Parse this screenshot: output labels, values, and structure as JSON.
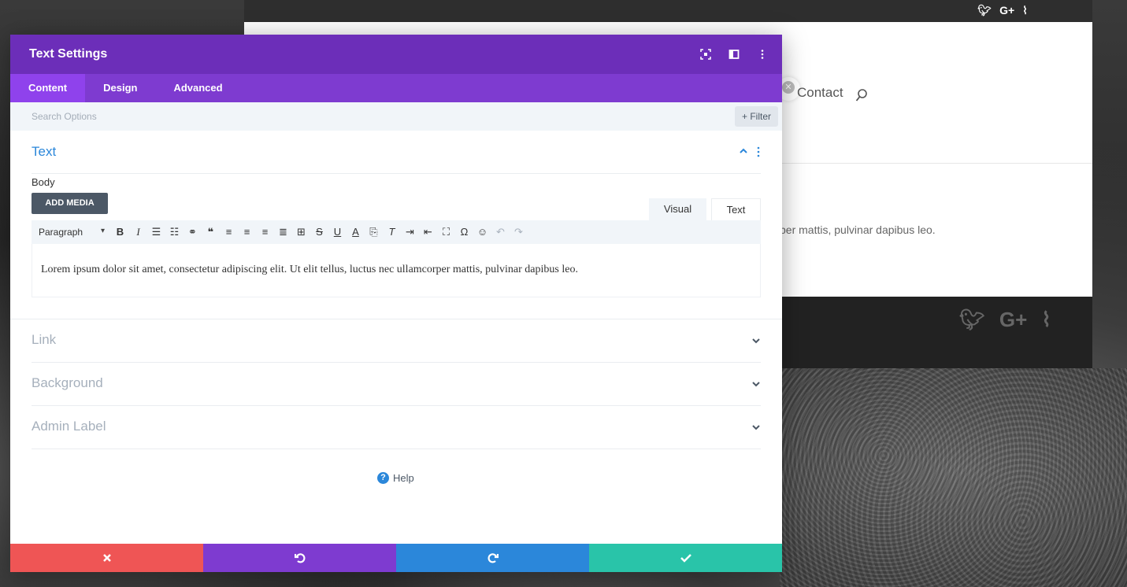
{
  "site": {
    "nav_contact": "Contact",
    "body_text": "per mattis, pulvinar dapibus leo.",
    "social_icons": [
      "twitter-icon",
      "google-plus-icon",
      "rss-icon"
    ]
  },
  "modal": {
    "title": "Text Settings",
    "header_icons": [
      "fullscreen-icon",
      "split-view-icon",
      "more-options-icon"
    ],
    "tabs": [
      {
        "label": "Content",
        "active": true
      },
      {
        "label": "Design",
        "active": false
      },
      {
        "label": "Advanced",
        "active": false
      }
    ],
    "search": {
      "placeholder": "Search Options",
      "filter_label": "+ Filter"
    },
    "text_section": {
      "title": "Text",
      "body_label": "Body",
      "add_media_label": "ADD MEDIA",
      "editor_tab_visual": "Visual",
      "editor_tab_text": "Text",
      "format_select": "Paragraph",
      "content": "Lorem ipsum dolor sit amet, consectetur adipiscing elit. Ut elit tellus, luctus nec ullamcorper mattis, pulvinar dapibus leo."
    },
    "toggles": [
      {
        "title": "Link"
      },
      {
        "title": "Background"
      },
      {
        "title": "Admin Label"
      }
    ],
    "help_label": "Help",
    "footer": {
      "colors": {
        "cancel": "#ef5555",
        "undo": "#7e3bd0",
        "redo": "#2b87da",
        "save": "#29c4a9"
      }
    }
  }
}
